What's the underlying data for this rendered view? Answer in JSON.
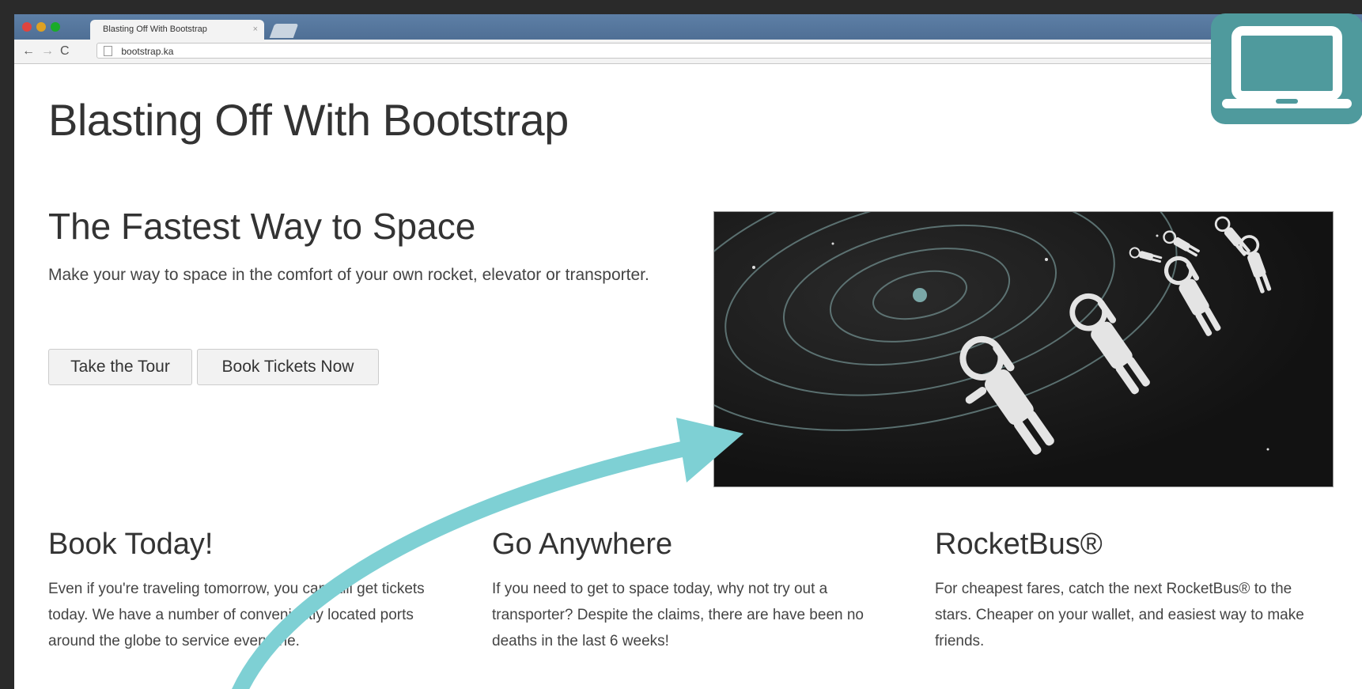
{
  "browser": {
    "tab_title": "Blasting Off With Bootstrap",
    "tab_close": "×",
    "url": "bootstrap.ka",
    "nav": {
      "back": "←",
      "forward": "→",
      "reload": "C"
    }
  },
  "page": {
    "title": "Blasting Off With Bootstrap",
    "hero": {
      "heading": "The Fastest Way to Space",
      "text": "Make your way to space in the comfort of your own rocket, elevator or transporter.",
      "buttons": [
        {
          "label": "Take the Tour"
        },
        {
          "label": "Book Tickets Now"
        }
      ]
    },
    "columns": [
      {
        "heading": "Book Today!",
        "text": "Even if you're traveling tomorrow, you can still get tickets today. We have a number of conveniently located ports around the globe to service everyone."
      },
      {
        "heading": "Go Anywhere",
        "text": "If you need to get to space today, why not try out a transporter? Despite the claims, there are have been no deaths in the last 6 weeks!"
      },
      {
        "heading": "RocketBus®",
        "text": "For cheapest fares, catch the next RocketBus® to the stars. Cheaper on your wallet, and easiest way to make friends."
      }
    ]
  },
  "overlay": {
    "badge_icon": "laptop-icon",
    "arrow_icon": "curved-arrow-icon",
    "accent_color": "#7ed0d4",
    "badge_color": "#4f9a9d"
  }
}
